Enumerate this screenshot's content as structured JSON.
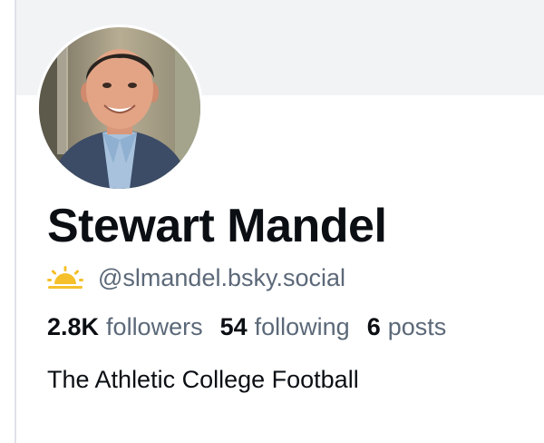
{
  "profile": {
    "display_name": "Stewart Mandel",
    "handle": "@slmandel.bsky.social",
    "handle_icon": "sunrise-icon",
    "bio": "The Athletic College Football",
    "avatar": "avatar-photo"
  },
  "stats": [
    {
      "value": "2.8K",
      "label": "followers"
    },
    {
      "value": "54",
      "label": "following"
    },
    {
      "value": "6",
      "label": "posts"
    }
  ],
  "colors": {
    "text_primary": "#0b0f14",
    "text_secondary": "#5b6878",
    "banner": "#f1f3f5",
    "sun_icon": "#f5c02a"
  }
}
